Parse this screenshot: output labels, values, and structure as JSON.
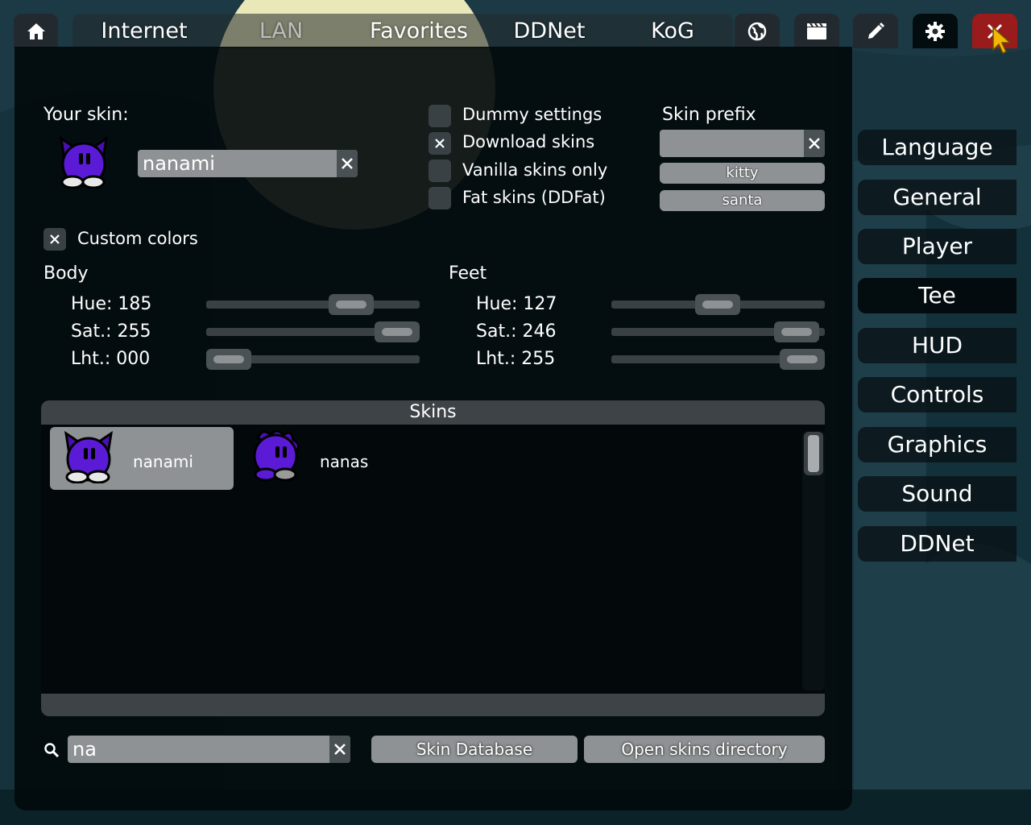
{
  "nav": {
    "tabs": [
      {
        "label": "Internet"
      },
      {
        "label": "LAN"
      },
      {
        "label": "Favorites"
      },
      {
        "label": "DDNet"
      },
      {
        "label": "KoG"
      }
    ],
    "icons": [
      "home-icon",
      "globe-icon",
      "film-icon",
      "pencil-icon",
      "gear-icon",
      "close-icon"
    ],
    "close_color": "#9a1b1b"
  },
  "skin": {
    "your_skin_label": "Your skin:",
    "name_value": "nanami"
  },
  "options": {
    "dummy_settings": "Dummy settings",
    "download_skins": "Download skins",
    "vanilla_only": "Vanilla skins only",
    "fat_skins": "Fat skins (DDFat)",
    "custom_colors": "Custom colors"
  },
  "prefix": {
    "label": "Skin prefix",
    "value": "",
    "suggestions": [
      "kitty",
      "santa"
    ]
  },
  "colors": {
    "body": {
      "title": "Body",
      "hue_label": "Hue: 185",
      "sat_label": "Sat.: 255",
      "lht_label": "Lht.: 000",
      "hue": 185,
      "sat": 255,
      "lht": 0
    },
    "feet": {
      "title": "Feet",
      "hue_label": "Hue: 127",
      "sat_label": "Sat.: 246",
      "lht_label": "Lht.: 255",
      "hue": 127,
      "sat": 246,
      "lht": 255
    }
  },
  "skins_list": {
    "title": "Skins",
    "items": [
      {
        "name": "nanami",
        "selected": true
      },
      {
        "name": "nanas",
        "selected": false
      }
    ]
  },
  "bottom": {
    "search_value": "na",
    "skin_database": "Skin Database",
    "open_dir": "Open skins directory"
  },
  "menu": {
    "items": [
      "Language",
      "General",
      "Player",
      "Tee",
      "HUD",
      "Controls",
      "Graphics",
      "Sound",
      "DDNet"
    ]
  }
}
